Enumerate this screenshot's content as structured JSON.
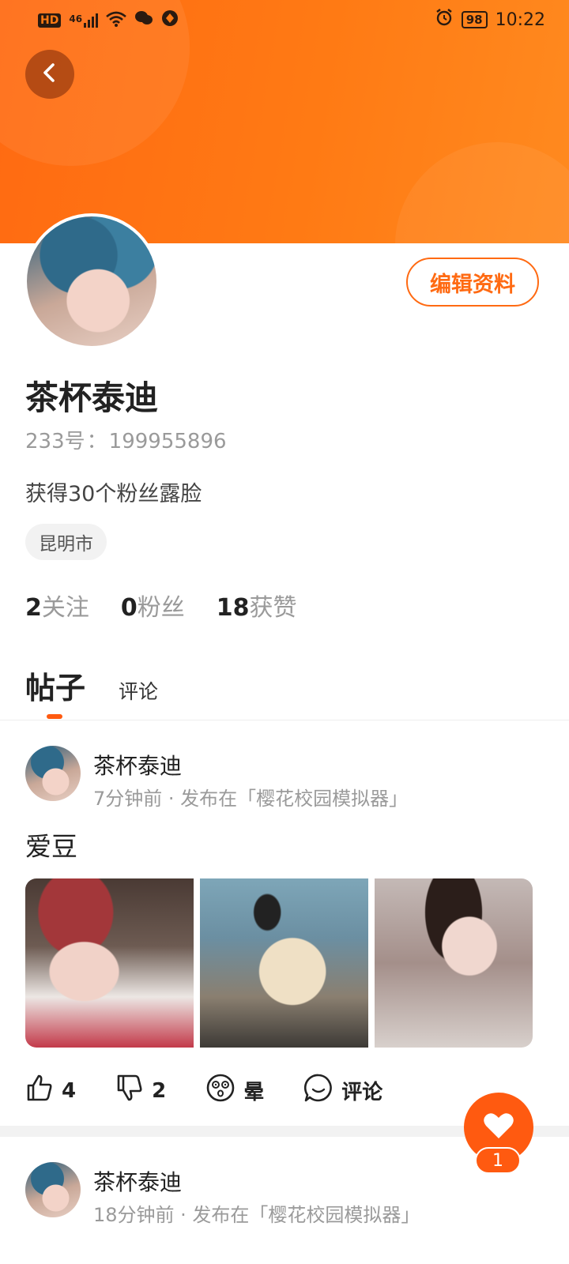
{
  "status_bar": {
    "left_chip": "HD",
    "signal": "46",
    "battery": "98",
    "time": "10:22"
  },
  "profile": {
    "name": "茶杯泰迪",
    "id_label": "233号",
    "id_sep": "：",
    "id_value": "199955896",
    "fans_note": "获得30个粉丝露脸",
    "city": "昆明市",
    "edit_label": "编辑资料",
    "stats": [
      {
        "num": "2",
        "label": "关注"
      },
      {
        "num": "0",
        "label": "粉丝"
      },
      {
        "num": "18",
        "label": "获赞"
      }
    ]
  },
  "tabs": {
    "active": "帖子",
    "other": "评论"
  },
  "posts": [
    {
      "author": "茶杯泰迪",
      "meta": "7分钟前 · 发布在「樱花校园模拟器」",
      "title": "爱豆",
      "likes": "4",
      "dislikes": "2",
      "dizzy": "晕",
      "comment": "评论"
    },
    {
      "author": "茶杯泰迪",
      "meta": "18分钟前 · 发布在「樱花校园模拟器」"
    }
  ],
  "fab": {
    "count": "1"
  },
  "colors": {
    "accent": "#ff6a12",
    "fab": "#ff5a10"
  }
}
